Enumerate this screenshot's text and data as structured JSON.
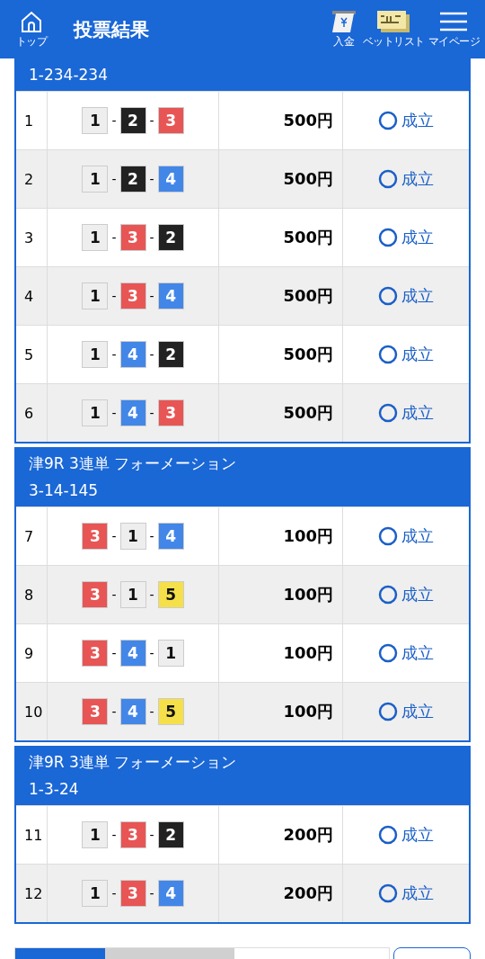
{
  "header": {
    "home_label": "トップ",
    "title": "投票結果",
    "nav": [
      {
        "kind": "deposit",
        "label": "入金"
      },
      {
        "kind": "betlist",
        "label": "ベットリスト"
      },
      {
        "kind": "menu",
        "label": "マイページ"
      }
    ]
  },
  "sections": [
    {
      "combo": "1-234-234",
      "rows": [
        {
          "no": "1",
          "boats": [
            {
              "num": "1",
              "color": "#eeeeee"
            },
            {
              "sep": "-",
              "num": "2",
              "color": "#222222"
            },
            {
              "sep": "-",
              "num": "3",
              "color": "#e85555"
            }
          ],
          "amount": "500円",
          "status": "成立"
        },
        {
          "no": "2",
          "boats": [
            {
              "num": "1",
              "color": "#eeeeee"
            },
            {
              "sep": "-",
              "num": "2",
              "color": "#222222"
            },
            {
              "sep": "-",
              "num": "4",
              "color": "#4286e8"
            }
          ],
          "amount": "500円",
          "status": "成立"
        },
        {
          "no": "3",
          "boats": [
            {
              "num": "1",
              "color": "#eeeeee"
            },
            {
              "sep": "-",
              "num": "3",
              "color": "#e85555"
            },
            {
              "sep": "-",
              "num": "2",
              "color": "#222222"
            }
          ],
          "amount": "500円",
          "status": "成立"
        },
        {
          "no": "4",
          "boats": [
            {
              "num": "1",
              "color": "#eeeeee"
            },
            {
              "sep": "-",
              "num": "3",
              "color": "#e85555"
            },
            {
              "sep": "-",
              "num": "4",
              "color": "#4286e8"
            }
          ],
          "amount": "500円",
          "status": "成立"
        },
        {
          "no": "5",
          "boats": [
            {
              "num": "1",
              "color": "#eeeeee"
            },
            {
              "sep": "-",
              "num": "4",
              "color": "#4286e8"
            },
            {
              "sep": "-",
              "num": "2",
              "color": "#222222"
            }
          ],
          "amount": "500円",
          "status": "成立"
        },
        {
          "no": "6",
          "boats": [
            {
              "num": "1",
              "color": "#eeeeee"
            },
            {
              "sep": "-",
              "num": "4",
              "color": "#4286e8"
            },
            {
              "sep": "-",
              "num": "3",
              "color": "#e85555"
            }
          ],
          "amount": "500円",
          "status": "成立"
        }
      ]
    },
    {
      "title": "津9R 3連単 フォーメーション",
      "combo": "3-14-145",
      "rows": [
        {
          "no": "7",
          "boats": [
            {
              "num": "3",
              "color": "#e85555"
            },
            {
              "sep": "-",
              "num": "1",
              "color": "#eeeeee"
            },
            {
              "sep": "-",
              "num": "4",
              "color": "#4286e8"
            }
          ],
          "amount": "100円",
          "status": "成立"
        },
        {
          "no": "8",
          "boats": [
            {
              "num": "3",
              "color": "#e85555"
            },
            {
              "sep": "-",
              "num": "1",
              "color": "#eeeeee"
            },
            {
              "sep": "-",
              "num": "5",
              "color": "#f5e04a"
            }
          ],
          "amount": "100円",
          "status": "成立"
        },
        {
          "no": "9",
          "boats": [
            {
              "num": "3",
              "color": "#e85555"
            },
            {
              "sep": "-",
              "num": "4",
              "color": "#4286e8"
            },
            {
              "sep": "-",
              "num": "1",
              "color": "#eeeeee"
            }
          ],
          "amount": "100円",
          "status": "成立"
        },
        {
          "no": "10",
          "boats": [
            {
              "num": "3",
              "color": "#e85555"
            },
            {
              "sep": "-",
              "num": "4",
              "color": "#4286e8"
            },
            {
              "sep": "-",
              "num": "5",
              "color": "#f5e04a"
            }
          ],
          "amount": "100円",
          "status": "成立"
        }
      ]
    },
    {
      "title": "津9R 3連単 フォーメーション",
      "combo": "1-3-24",
      "rows": [
        {
          "no": "11",
          "boats": [
            {
              "num": "1",
              "color": "#eeeeee"
            },
            {
              "sep": "-",
              "num": "3",
              "color": "#e85555"
            },
            {
              "sep": "-",
              "num": "2",
              "color": "#222222"
            }
          ],
          "amount": "200円",
          "status": "成立"
        },
        {
          "no": "12",
          "boats": [
            {
              "num": "1",
              "color": "#eeeeee"
            },
            {
              "sep": "-",
              "num": "3",
              "color": "#e85555"
            },
            {
              "sep": "-",
              "num": "4",
              "color": "#4286e8"
            }
          ],
          "amount": "200円",
          "status": "成立"
        }
      ]
    }
  ]
}
